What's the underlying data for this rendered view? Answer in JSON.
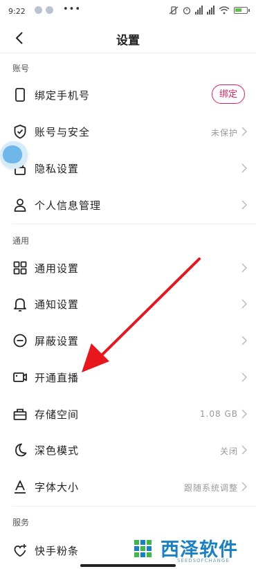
{
  "status_bar": {
    "time": "9:22",
    "more": "•••",
    "battery_color": "#5cc34a"
  },
  "header": {
    "title": "设置"
  },
  "sections": {
    "account": {
      "title": "账号",
      "items": [
        {
          "label": "绑定手机号",
          "icon": "phone-icon",
          "button": "绑定"
        },
        {
          "label": "账号与安全",
          "icon": "shield-check-icon",
          "value": "未保护"
        },
        {
          "label": "隐私设置",
          "icon": "lock-icon"
        },
        {
          "label": "个人信息管理",
          "icon": "user-icon"
        }
      ]
    },
    "general": {
      "title": "通用",
      "items": [
        {
          "label": "通用设置",
          "icon": "grid-icon"
        },
        {
          "label": "通知设置",
          "icon": "bell-icon"
        },
        {
          "label": "屏蔽设置",
          "icon": "block-icon"
        },
        {
          "label": "开通直播",
          "icon": "video-camera-icon"
        },
        {
          "label": "存储空间",
          "icon": "storage-icon",
          "value": "1.08 GB"
        },
        {
          "label": "深色模式",
          "icon": "moon-icon",
          "value": "关闭"
        },
        {
          "label": "字体大小",
          "icon": "font-size-icon",
          "value": "跟随系统调整"
        }
      ]
    },
    "service": {
      "title": "服务",
      "items": [
        {
          "label": "快手粉条",
          "icon": "fans-promo-icon"
        }
      ]
    }
  },
  "annotation": {
    "arrow_color": "#e8171d"
  },
  "watermark": {
    "text": "西泽软件",
    "sub": "SEEDSOFCHANGE",
    "color": "#1780c7"
  }
}
